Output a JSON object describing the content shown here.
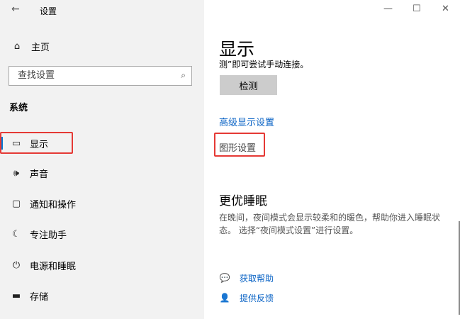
{
  "window": {
    "title": "设置",
    "back_icon": "←",
    "minimize_icon": "—",
    "maximize_icon": "☐",
    "close_icon": "✕"
  },
  "sidebar": {
    "home": {
      "icon": "⌂",
      "label": "主页"
    },
    "search": {
      "placeholder": "查找设置",
      "icon": "⌕"
    },
    "section_title": "系统",
    "items": [
      {
        "icon": "▭",
        "label": "显示",
        "active": true
      },
      {
        "icon": "🕪",
        "label": "声音",
        "active": false
      },
      {
        "icon": "▢",
        "label": "通知和操作",
        "active": false
      },
      {
        "icon": "☾",
        "label": "专注助手",
        "active": false
      },
      {
        "icon": "⏻",
        "label": "电源和睡眠",
        "active": false
      },
      {
        "icon": "▬",
        "label": "存储",
        "active": false
      }
    ]
  },
  "main": {
    "title": "显示",
    "cut_text": "测”即可尝试手动连接。",
    "detect_button": "检测",
    "advanced_link": "高级显示设置",
    "graphics_link": "图形设置",
    "sleep_heading": "更优睡眠",
    "sleep_desc": "在晚间，夜间模式会显示较柔和的暖色，帮助你进入睡眠状态。 选择“夜间模式设置”进行设置。",
    "help": [
      {
        "icon": "💬",
        "label": "获取帮助"
      },
      {
        "icon": "👤",
        "label": "提供反馈"
      }
    ]
  },
  "colors": {
    "accent": "#0078d7",
    "link": "#0a63c5",
    "highlight_box": "#e53935",
    "sidebar_bg": "#f2f2f2"
  }
}
